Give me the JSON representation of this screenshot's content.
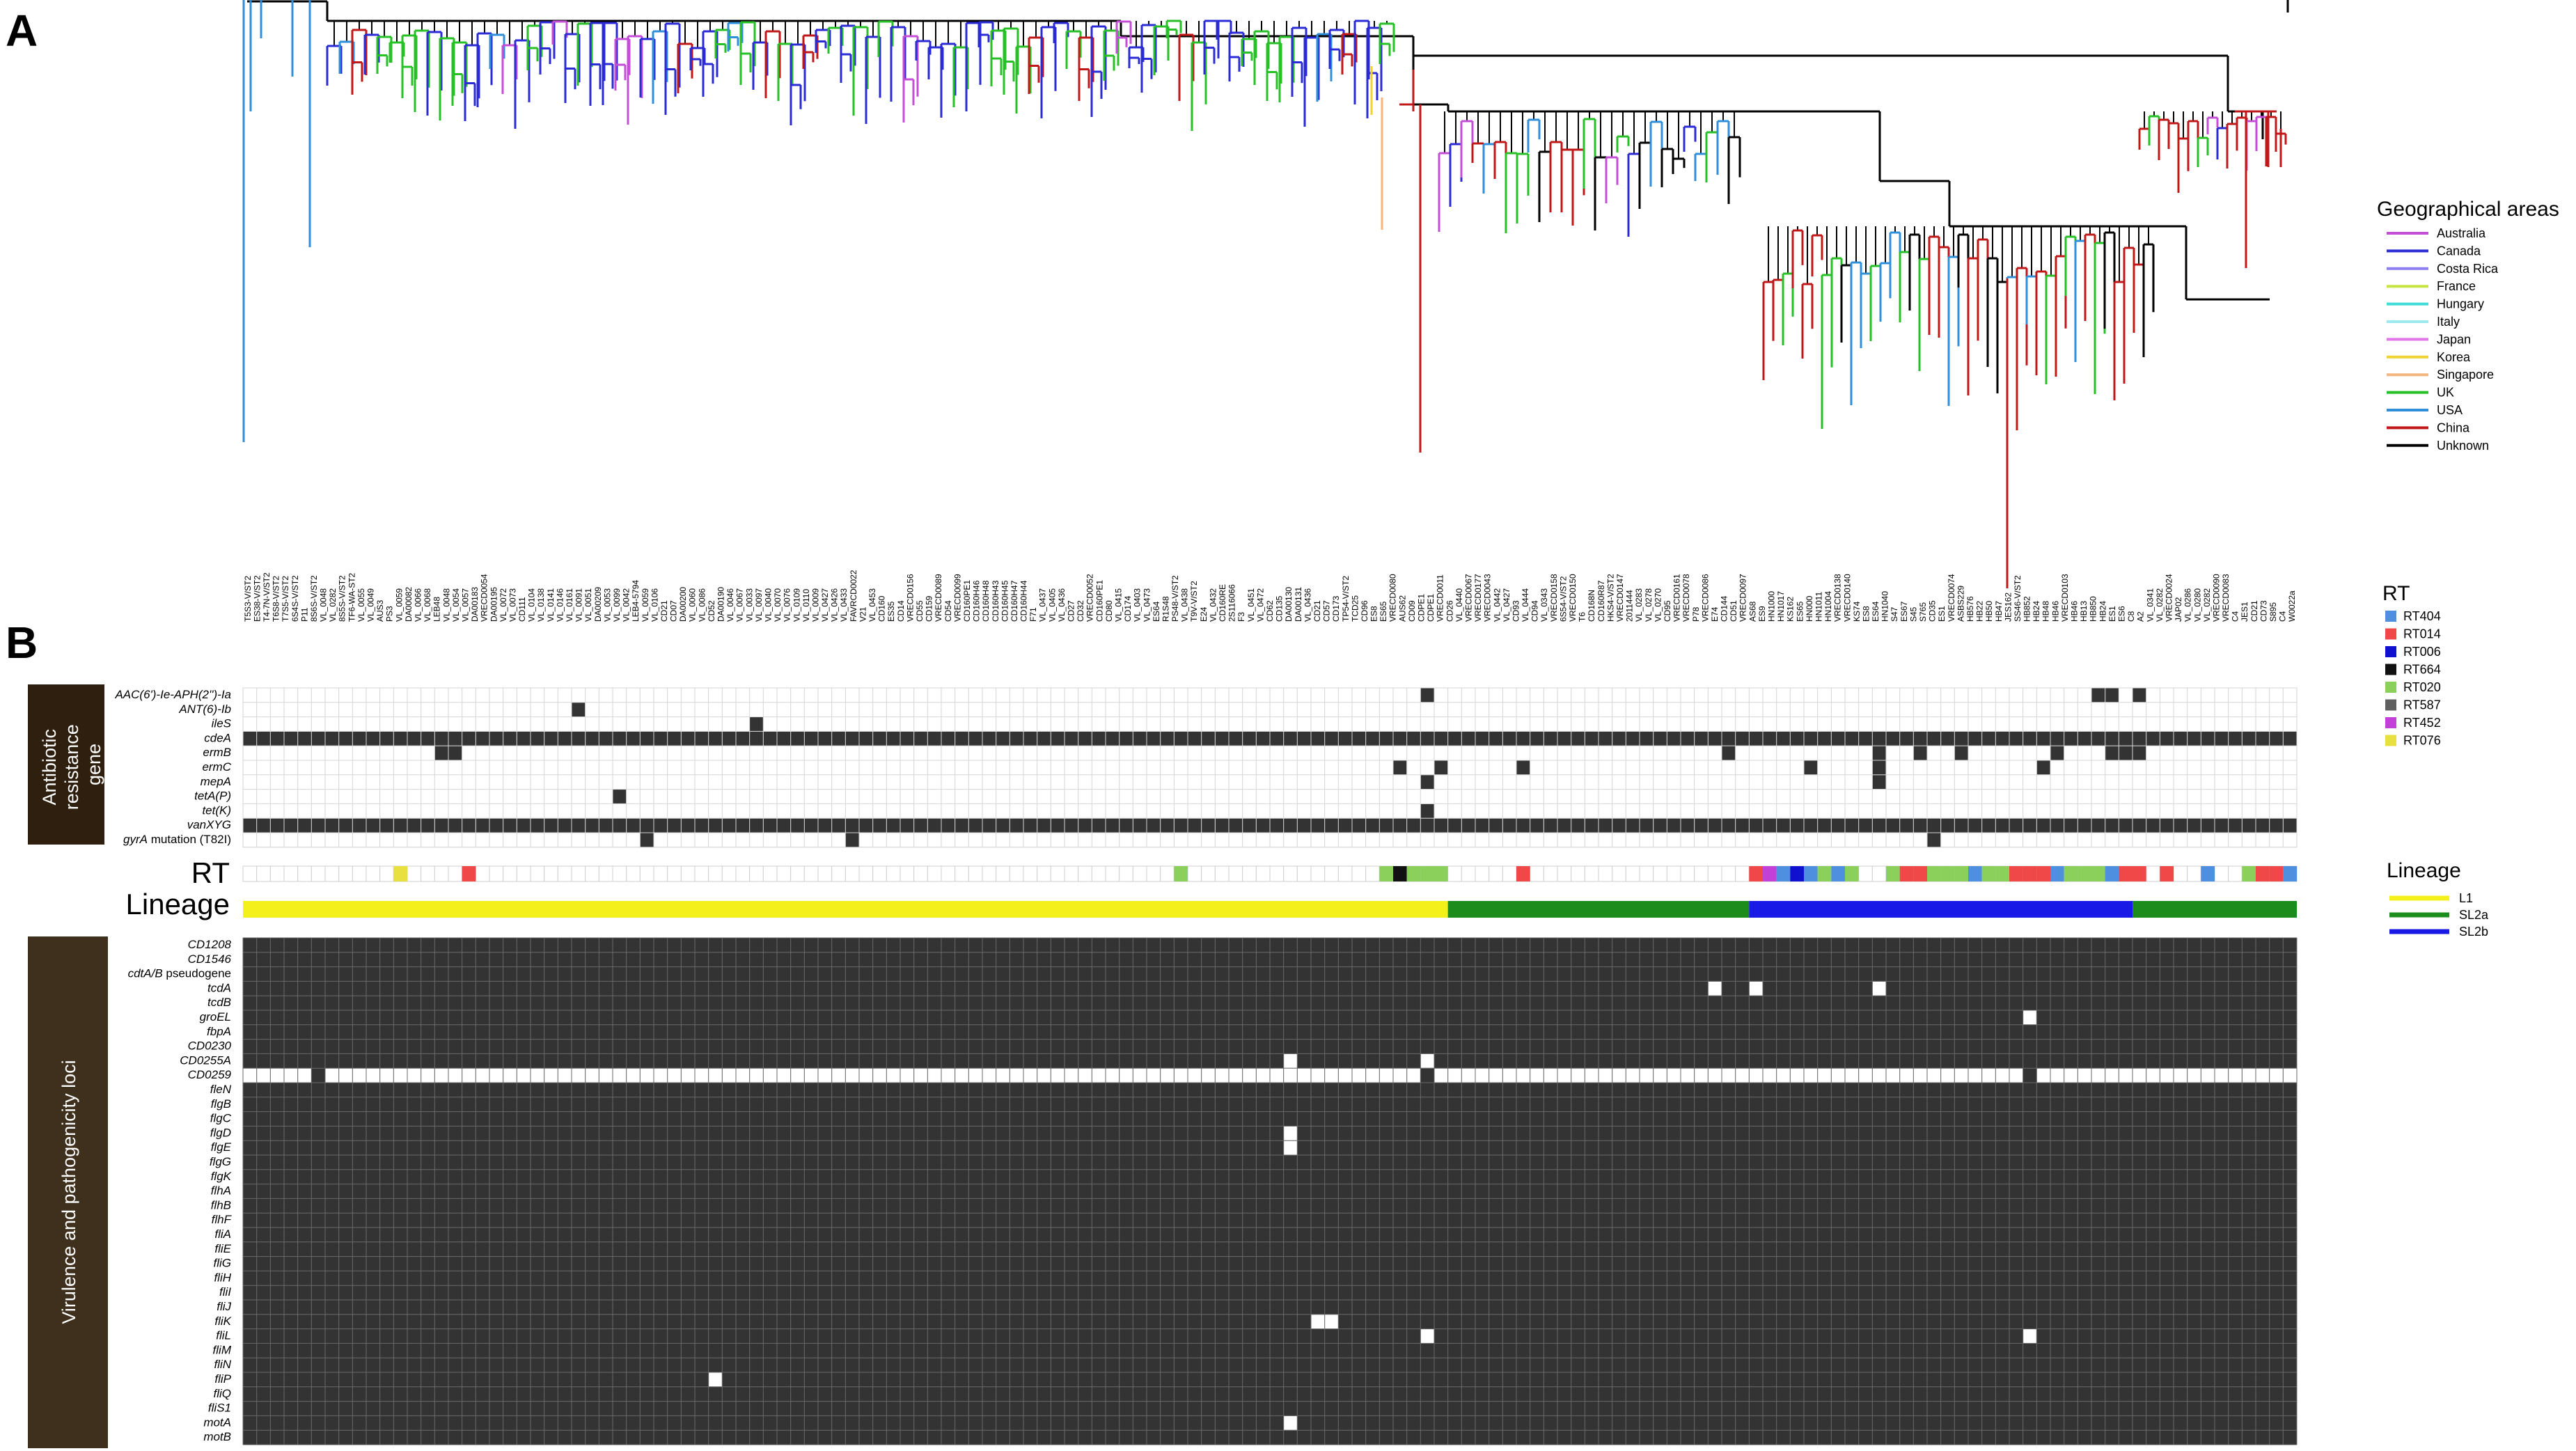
{
  "panels": {
    "a": "A",
    "b": "B"
  },
  "geo_legend": {
    "title": "Geographical areas",
    "items": [
      {
        "label": "Australia",
        "color": "#c44fd6"
      },
      {
        "label": "Canada",
        "color": "#2b2bd6"
      },
      {
        "label": "Costa Rica",
        "color": "#8a7ef0"
      },
      {
        "label": "France",
        "color": "#c8e640"
      },
      {
        "label": "Hungary",
        "color": "#40dcd8"
      },
      {
        "label": "Italy",
        "color": "#9ee8f0"
      },
      {
        "label": "Japan",
        "color": "#e276e6"
      },
      {
        "label": "Korea",
        "color": "#f2d230"
      },
      {
        "label": "Singapore",
        "color": "#f5b580"
      },
      {
        "label": "UK",
        "color": "#27c027"
      },
      {
        "label": "USA",
        "color": "#2f8fd8"
      },
      {
        "label": "China",
        "color": "#c01818"
      },
      {
        "label": "Unknown",
        "color": "#000000"
      }
    ]
  },
  "rt_legend": {
    "title": "RT",
    "items": [
      {
        "label": "RT404",
        "color": "#4f8fe0"
      },
      {
        "label": "RT014",
        "color": "#f04848"
      },
      {
        "label": "RT006",
        "color": "#1010d0"
      },
      {
        "label": "RT664",
        "color": "#111111"
      },
      {
        "label": "RT020",
        "color": "#8ad05a"
      },
      {
        "label": "RT587",
        "color": "#606060"
      },
      {
        "label": "RT452",
        "color": "#c040d8"
      },
      {
        "label": "RT076",
        "color": "#e8e040"
      }
    ]
  },
  "lineage_legend": {
    "title": "Lineage",
    "items": [
      {
        "label": "L1",
        "color": "#f4f01c"
      },
      {
        "label": "SL2a",
        "color": "#1c8c1c"
      },
      {
        "label": "SL2b",
        "color": "#1a1ae6"
      }
    ]
  },
  "side_labels": {
    "antibiotic": [
      "Antibiotic",
      "resistance",
      "gene"
    ],
    "virulence": "Virulence and pathogenicity loci",
    "rt_row": "RT",
    "lineage_row": "Lineage"
  },
  "resistance_genes": [
    "AAC(6')-Ie-APH(2'')-Ia",
    "ANT(6)-Ib",
    "ileS",
    "cdeA",
    "ermB",
    "ermC",
    "mepA",
    "tetA(P)",
    "tet(K)",
    "vanXYG",
    "gyrA mutation (T82I)"
  ],
  "virulence_genes": [
    "CD1208",
    "CD1546",
    "cdtA/B pseudogene",
    "tcdA",
    "tcdB",
    "groEL",
    "fbpA",
    "CD0230",
    "CD0255A",
    "CD0259",
    "fleN",
    "flgB",
    "flgC",
    "flgD",
    "flgE",
    "flgG",
    "flgK",
    "flhA",
    "flhB",
    "flhF",
    "fliA",
    "fliE",
    "fliG",
    "fliH",
    "fliI",
    "fliJ",
    "fliK",
    "fliL",
    "fliM",
    "fliN",
    "fliP",
    "fliQ",
    "fliS1",
    "motA",
    "motB"
  ],
  "taxa": [
    "T5S3-V/ST2",
    "ES38-V/ST2",
    "T4-7N-V/ST2",
    "T6S8-V/ST2",
    "T7S5-V/ST2",
    "6S4S-V/ST2",
    "P11",
    "8S6S-V/ST2",
    "VL_0048",
    "VL_0282",
    "8S5S-V/ST2",
    "TF6-WA-ST2",
    "VL_0055",
    "VL_0049",
    "AUS3",
    "PS3",
    "VL_0059",
    "DA00082",
    "VL_0066",
    "VL_0068",
    "LEB48",
    "VL_0048",
    "VL_0054",
    "VL_0057",
    "DA00183",
    "VRECD0054",
    "DA00195",
    "VL_0072",
    "VL_0073",
    "CD111",
    "VL_0104",
    "VL_0138",
    "VL_0141",
    "VL_0146",
    "VL_0161",
    "VL_0091",
    "VL_0051",
    "DA00209",
    "VL_0053",
    "VL_0099",
    "VL_0042",
    "LEB4-5794",
    "VL_0059",
    "VL_0106",
    "CD21",
    "CD07",
    "DA00200",
    "VL_0060",
    "VL_0086",
    "CD52",
    "DA00190",
    "VL_0046",
    "VL_0067",
    "VL_0033",
    "VL_0097",
    "VL_0040",
    "VL_0070",
    "VL_0076",
    "VL_0109",
    "VL_0110",
    "VL_0009",
    "VL_0427",
    "VL_0426",
    "VL_0433",
    "FAVRCD0022",
    "V21",
    "VL_0453",
    "CD160",
    "ES35",
    "CD14",
    "VRECD0156",
    "CD55",
    "CD159",
    "VRECD0089",
    "CD54",
    "VRECD0099",
    "CD160PE1",
    "CD160H46",
    "CD160H48",
    "CD160H43",
    "CD160H45",
    "CD160H47",
    "CD160H44",
    "F71",
    "VL_0437",
    "VL_0405",
    "VL_0436",
    "CD27",
    "CD32",
    "VRECD0052",
    "CD160PE1",
    "CD80",
    "VL_0415",
    "CD174",
    "VL_0403",
    "VL_0473",
    "ES64",
    "R1S48",
    "PS48-V/ST2",
    "VL_0438",
    "T9V-V/ST2",
    "E24",
    "VL_0432",
    "CD160RE",
    "2S116066",
    "F3",
    "VL_0451",
    "VL_0472",
    "CD62",
    "CD135",
    "DA00130",
    "DA00131",
    "VL_0436",
    "CD21",
    "CD57",
    "CD173",
    "TP54-V/ST2",
    "TCD25",
    "CD96",
    "ES8",
    "ES65",
    "VRECD0080",
    "AUS62",
    "CD09",
    "CDPE1",
    "CDPE1",
    "VRECD0011",
    "CD26",
    "VL_0440",
    "VRECD0067",
    "VRECD0177",
    "VRECD0043",
    "VL_0442",
    "VL_0427",
    "CD93",
    "VL_0444",
    "CD94",
    "VL_0343",
    "VRECD0158",
    "6S54-V/ST2",
    "VRECD0150",
    "T6",
    "CD168N",
    "CD160R87",
    "HKS4-V/ST2",
    "VRECD0147",
    "2011444",
    "VL_0283",
    "VL_0278",
    "VL_0270",
    "CD95",
    "VRECD0161",
    "VRECD0078",
    "P78",
    "VRECD0086",
    "E74",
    "CD144",
    "CD51",
    "VRECD0097",
    "AS68",
    "ES9",
    "HN1000",
    "HN1017",
    "KS162",
    "ES65",
    "HN000",
    "HN1011",
    "HN1004",
    "VRECD0138",
    "VRECD0140",
    "KS74",
    "ES8",
    "ES64",
    "HN1040",
    "S47",
    "ES67",
    "S45",
    "S765",
    "CD35",
    "ES1",
    "VRECD0074",
    "ASBS229",
    "HB576",
    "HB22",
    "HB50",
    "HB47",
    "JES162",
    "SS46-V/ST2",
    "HB852",
    "HB24",
    "HB48",
    "HB46",
    "VRECD0103",
    "HB46",
    "HB13",
    "HB850",
    "HB24",
    "ES1",
    "ES6",
    "C8",
    "A2",
    "VL_0341",
    "VL_0282",
    "VRECD0024",
    "JAP02",
    "VL_0286",
    "VL_0280",
    "VL_0282",
    "VRECD0090",
    "VRECD0083",
    "C4",
    "JES1",
    "CD21",
    "CD73",
    "S895",
    "C4",
    "W0022a"
  ],
  "matrix_notes": "Presence/absence grid; dark cell = present"
}
